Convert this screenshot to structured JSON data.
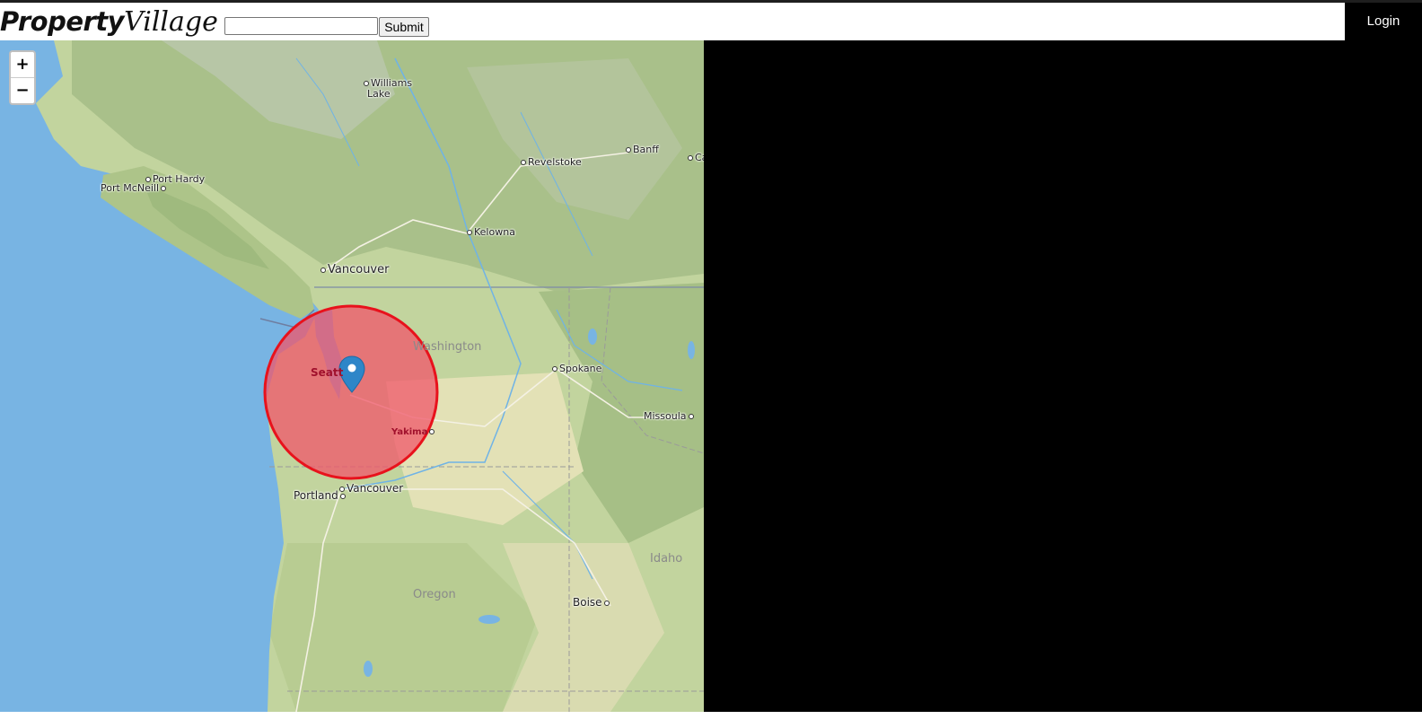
{
  "header": {
    "logo_bold": "Property",
    "logo_italic": "Village",
    "search_value": "",
    "submit_label": "Submit",
    "login_label": "Login"
  },
  "map": {
    "zoom_in_label": "+",
    "zoom_out_label": "−",
    "places": {
      "williams_lake_1": "Williams",
      "williams_lake_2": "Lake",
      "port_hardy": "Port Hardy",
      "port_mcneill": "Port McNeill",
      "revelstoke": "Revelstoke",
      "banff": "Banff",
      "calgary_partial": "Ca",
      "kelowna": "Kelowna",
      "vancouver_bc": "Vancouver",
      "washington": "Washington",
      "seattle_partial": "Seatt",
      "spokane": "Spokane",
      "missoula": "Missoula",
      "yakima": "Yakima",
      "portland": "Portland",
      "vancouver_wa": "Vancouver",
      "idaho": "Idaho",
      "oregon": "Oregon",
      "boise": "Boise"
    },
    "colors": {
      "ocean": "#78b4e3",
      "land": "#bfd29a",
      "radius_fill": "#f0556a",
      "radius_stroke": "#e8121c",
      "marker": "#2e86c8"
    }
  }
}
